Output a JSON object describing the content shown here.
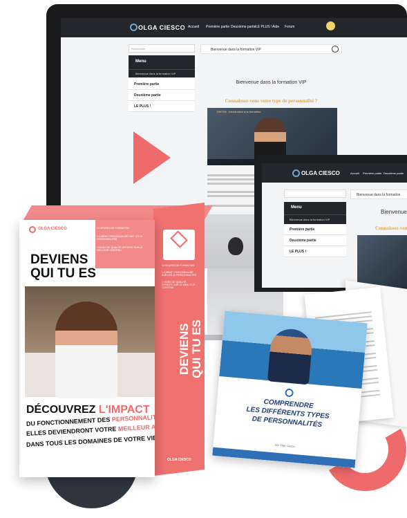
{
  "brand": "OLGA CIESCO",
  "imac": {
    "nav_items": [
      "Accueil",
      "Première partie",
      "Deuxième partie",
      "LE PLUS !",
      "Aide",
      "Forum"
    ],
    "search_placeholder": "Rechercher",
    "menu_title": "Menu",
    "menu_sub": "Bienvenue dans la formation VIP",
    "menu_items": [
      "Première partie",
      "Deuxième partie",
      "LE PLUS !"
    ],
    "breadcrumb": "Bienvenue dans la formation VIP",
    "page_title": "Bienvenue dans la formation VIP",
    "subtitle": "Connaissez-vous votre type de personnalité ?",
    "video_title": "DIKTIM - Introduction à la formation"
  },
  "laptop": {
    "brand": "OLGA CIESCO",
    "nav_items": [
      "Accueil",
      "Première partie",
      "Deuxième partie"
    ],
    "breadcrumb": "Bienvenue dans la formation",
    "menu_title": "Menu",
    "menu_sub": "Bienvenue dans la formation VIP",
    "menu_items": [
      "Première partie",
      "Deuxième partie",
      "LE PLUS !"
    ],
    "page_title": "Bienvenue",
    "subtitle": "Connaissez-vous"
  },
  "box": {
    "brand": "OLGA CIESCO",
    "features": [
      "12 HEURES DE FORMATION",
      "1 CARNET PERSONNALISÉ SUR LES 16 PERSONNALITÉS",
      "1 VIDÉO DE QUALITÉ OFFERTE SUR LE MEILLEUR CONTENU"
    ],
    "title_line1": "DEVIENS",
    "title_line2": "QUI TU ES",
    "headline_a": "DÉCOUVREZ",
    "headline_b": "L'IMPACT",
    "line2": "DU FONCTIONNEMENT DES",
    "line2_hl": "PERSONNALITÉS,",
    "line3": "ELLES DEVIENDRONT VOTRE",
    "line3_hl": "MEILLEUR ATOUT",
    "line4": "DANS TOUS LES DOMAINES DE VOTRE VIE",
    "side_features": [
      "12 HEURES DE FORMATION",
      "1 CARNET PERSONNALISÉ SUR LES 16 PERSONNALITÉS",
      "1 VIDÉO DE QUALITÉ OFFERTE SUR LE MEILLEUR CONTENU"
    ],
    "side_title": "DEVIENS\nQUI TU ES",
    "side_logo": "OLGA CIESCO"
  },
  "booklet": {
    "title": "COMPRENDRE\nLES DIFFÉRENTS TYPES\nDE PERSONNALITÉS",
    "author": "par Olga Ciesco"
  },
  "colors": {
    "accent": "#ef6b6b",
    "dark": "#23262b",
    "gold": "#e5a94a",
    "blue": "#1f3e74"
  }
}
